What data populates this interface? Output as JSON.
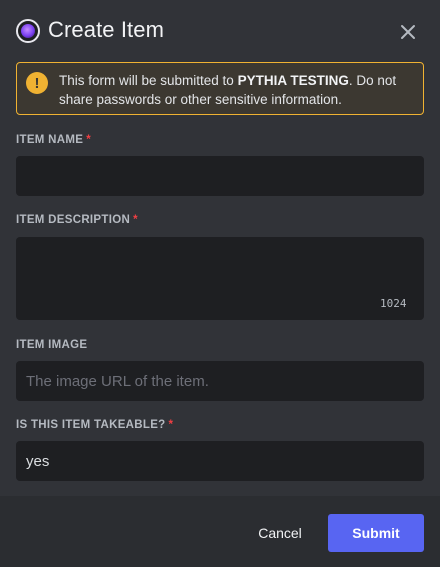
{
  "dialog": {
    "title": "Create Item",
    "close_icon": "close-icon",
    "app_icon": "app-icon"
  },
  "notice": {
    "icon": "warning-icon",
    "icon_glyph": "!",
    "text_before": "This form will be submitted to ",
    "target": "PYTHIA TESTING",
    "text_after": ". Do not share passwords or other sensitive information."
  },
  "fields": {
    "item_name": {
      "label": "ITEM NAME",
      "required": "*",
      "value": ""
    },
    "item_description": {
      "label": "ITEM DESCRIPTION",
      "required": "*",
      "value": "",
      "counter": "1024"
    },
    "item_image": {
      "label": "ITEM IMAGE",
      "placeholder": "The image URL of the item.",
      "value": ""
    },
    "takeable": {
      "label": "IS THIS ITEM TAKEABLE?",
      "required": "*",
      "value": "yes"
    }
  },
  "footer": {
    "cancel_label": "Cancel",
    "submit_label": "Submit"
  },
  "colors": {
    "background": "#313338",
    "footer": "#2b2d31",
    "input": "#1e1f22",
    "accent": "#5865f2",
    "warning": "#f0b232",
    "required": "#f23f43"
  }
}
